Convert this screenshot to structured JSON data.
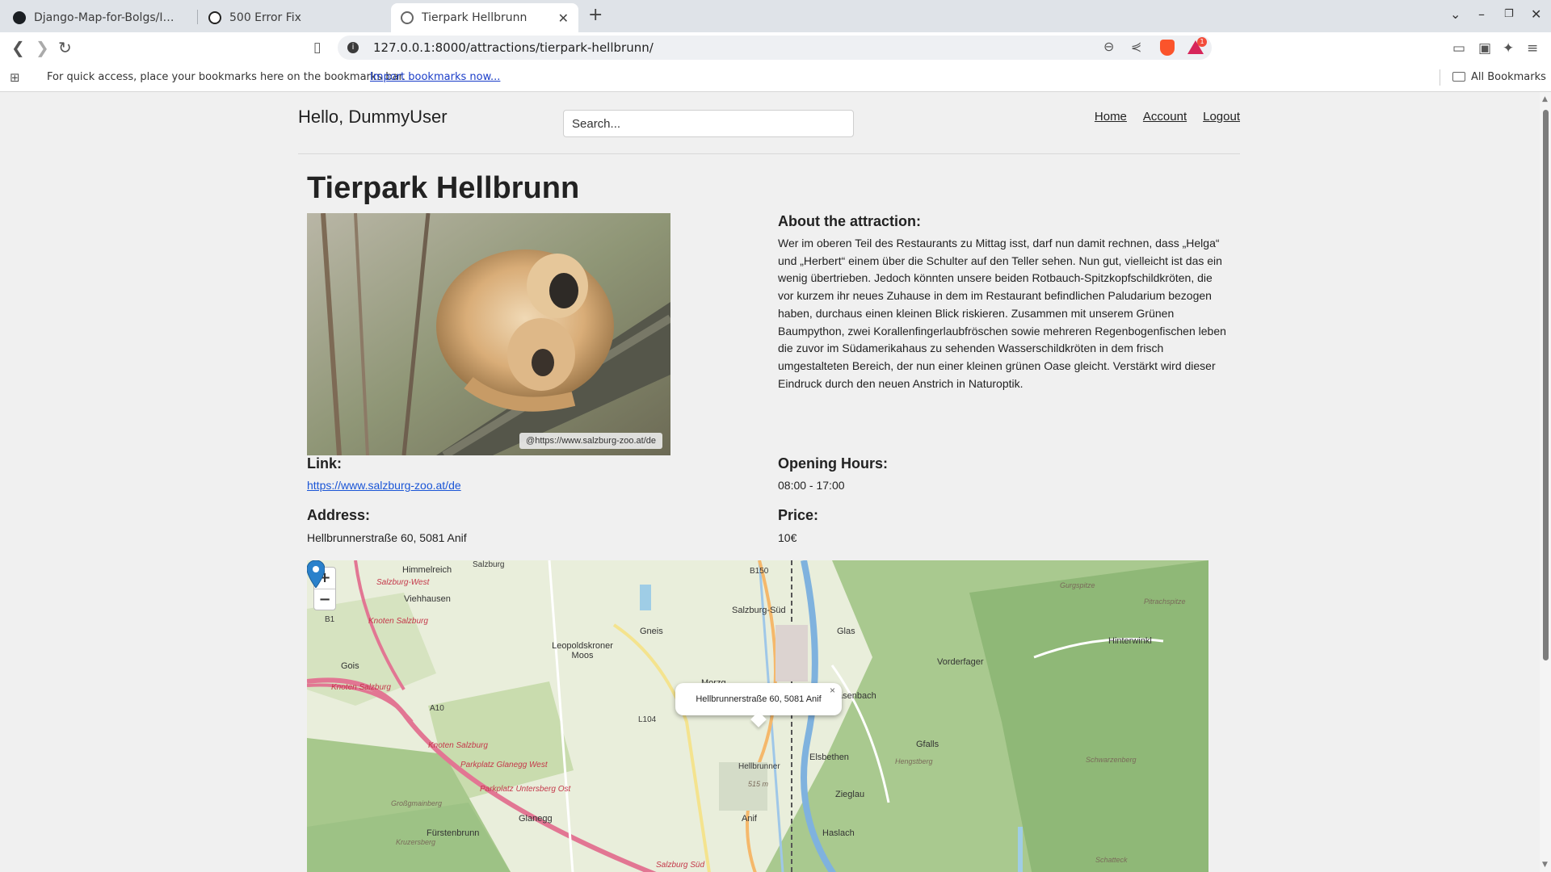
{
  "browser": {
    "tabs": [
      {
        "title": "Django-Map-for-Bolgs/Images at",
        "active": false
      },
      {
        "title": "500 Error Fix",
        "active": false
      },
      {
        "title": "Tierpark Hellbrunn",
        "active": true
      }
    ],
    "url": "127.0.0.1:8000/attractions/tierpark-hellbrunn/",
    "rewards_badge": "1",
    "bookmarks_hint": "For quick access, place your bookmarks here on the bookmarks bar.",
    "import_bookmarks": "Import bookmarks now...",
    "all_bookmarks": "All Bookmarks"
  },
  "header": {
    "greeting": "Hello, DummyUser",
    "search_placeholder": "Search...",
    "nav": [
      "Home",
      "Account",
      "Logout"
    ]
  },
  "attraction": {
    "title": "Tierpark Hellbrunn",
    "image_credit": "@https://www.salzburg-zoo.at/de",
    "about_heading": "About the attraction:",
    "about_text": "Wer im oberen Teil des Restaurants zu Mittag isst, darf nun damit rechnen, dass „Helga“ und „Herbert“ einem über die Schulter auf den Teller sehen. Nun gut, vielleicht ist das ein wenig übertrieben. Jedoch könnten unsere beiden Rotbauch-Spitzkopfschildkröten, die vor kurzem ihr neues Zuhause in dem im Restaurant befindlichen Paludarium bezogen haben, durchaus einen kleinen Blick riskieren. Zusammen mit unserem Grünen Baumpython, zwei Korallenfingerlaubfröschen sowie mehreren Regenbogenfischen leben die zuvor im Südamerikahaus zu sehenden Wasserschildkröten in dem frisch umgestalteten Bereich, der nun einer kleinen grünen Oase gleicht. Verstärkt wird dieser Eindruck durch den neuen Anstrich in Naturoptik.",
    "link_heading": "Link:",
    "link": "https://www.salzburg-zoo.at/de",
    "hours_heading": "Opening Hours:",
    "hours": "08:00 - 17:00",
    "address_heading": "Address:",
    "address": "Hellbrunnerstraße 60, 5081 Anif",
    "price_heading": "Price:",
    "price": "10€"
  },
  "map": {
    "zoom_in": "+",
    "zoom_out": "−",
    "popup": "Hellbrunnerstraße 60, 5081 Anif",
    "popup_close": "×",
    "labels": [
      "Himmelreich",
      "Salzburg",
      "Salzburg-West",
      "Viehhausen",
      "B1",
      "Knoten Salzburg",
      "Gois",
      "Knoten Salzburg",
      "B150",
      "Salzburg-Süd",
      "Glas",
      "Gneis",
      "Leopoldskroner Moos",
      "Morzg",
      "Glasenbach",
      "A10",
      "L104",
      "Elsbethen",
      "Gfalls",
      "Hengstberg",
      "Vorderfager",
      "Hinterwinkl",
      "Gurgspitze",
      "Pitrachspitze",
      "Knoten Salzburg",
      "Parkplatz Glanegg West",
      "Parkplatz Untersberg Ost",
      "Großgmainberg",
      "Glanegg",
      "Anif",
      "Zieglau",
      "Haslach",
      "Fürstenbrunn",
      "Kruzersberg",
      "Schwarzenberg",
      "Schatteck",
      "Salzburg Süd",
      "Hellbrunner",
      "515 m"
    ]
  }
}
